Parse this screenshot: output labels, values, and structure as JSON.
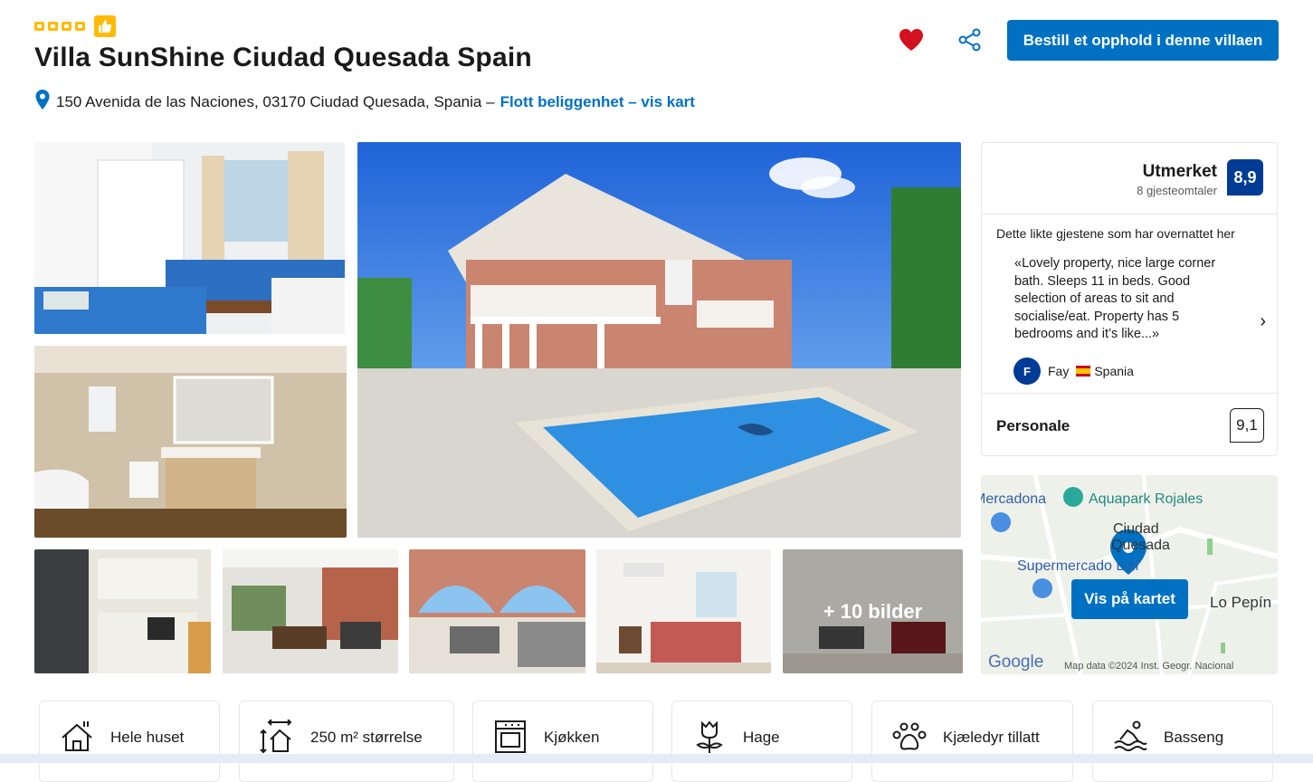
{
  "header": {
    "title": "Villa SunShine Ciudad Quesada Spain",
    "stars": 4,
    "address": "150 Avenida de las Naciones, 03170 Ciudad Quesada, Spania –",
    "location_link": "Flott beliggenhet – vis kart",
    "book_button": "Bestill et opphold i denne villaen",
    "colors": {
      "accent": "#0071c2",
      "star": "#febb02",
      "heart": "#d4111e",
      "score": "#003b95"
    }
  },
  "gallery": {
    "more_label": "+ 10 bilder"
  },
  "review": {
    "rating_word": "Utmerket",
    "review_count": "8 gjesteomtaler",
    "score": "8,9",
    "heading": "Dette likte gjestene som har overnattet her",
    "quote": "«Lovely property, nice large corner bath. Sleeps 11 in beds. Good selection of areas to sit and socialise/eat. Property has 5 bedrooms and it’s like...»",
    "author_initial": "F",
    "author": "Fay",
    "author_country": "Spania",
    "staff_label": "Personale",
    "staff_score": "9,1"
  },
  "map": {
    "button": "Vis på kartet",
    "labels": {
      "mercadona": "Mercadona",
      "aquapark": "Aquapark Rojales",
      "city_line1": "Ciudad",
      "city_line2": "Quesada",
      "supermercado": "Supermercado Lidl",
      "lo_pepin": "Lo Pepín",
      "google": "Google",
      "attribution": "Map data ©2024 Inst. Geogr. Nacional"
    }
  },
  "amenities": [
    {
      "icon": "house-icon",
      "label": "Hele huset"
    },
    {
      "icon": "size-icon",
      "label": "250 m² størrelse"
    },
    {
      "icon": "oven-icon",
      "label": "Kjøkken"
    },
    {
      "icon": "flower-icon",
      "label": "Hage"
    },
    {
      "icon": "paw-icon",
      "label": "Kjæledyr tillatt"
    },
    {
      "icon": "pool-icon",
      "label": "Basseng"
    }
  ]
}
